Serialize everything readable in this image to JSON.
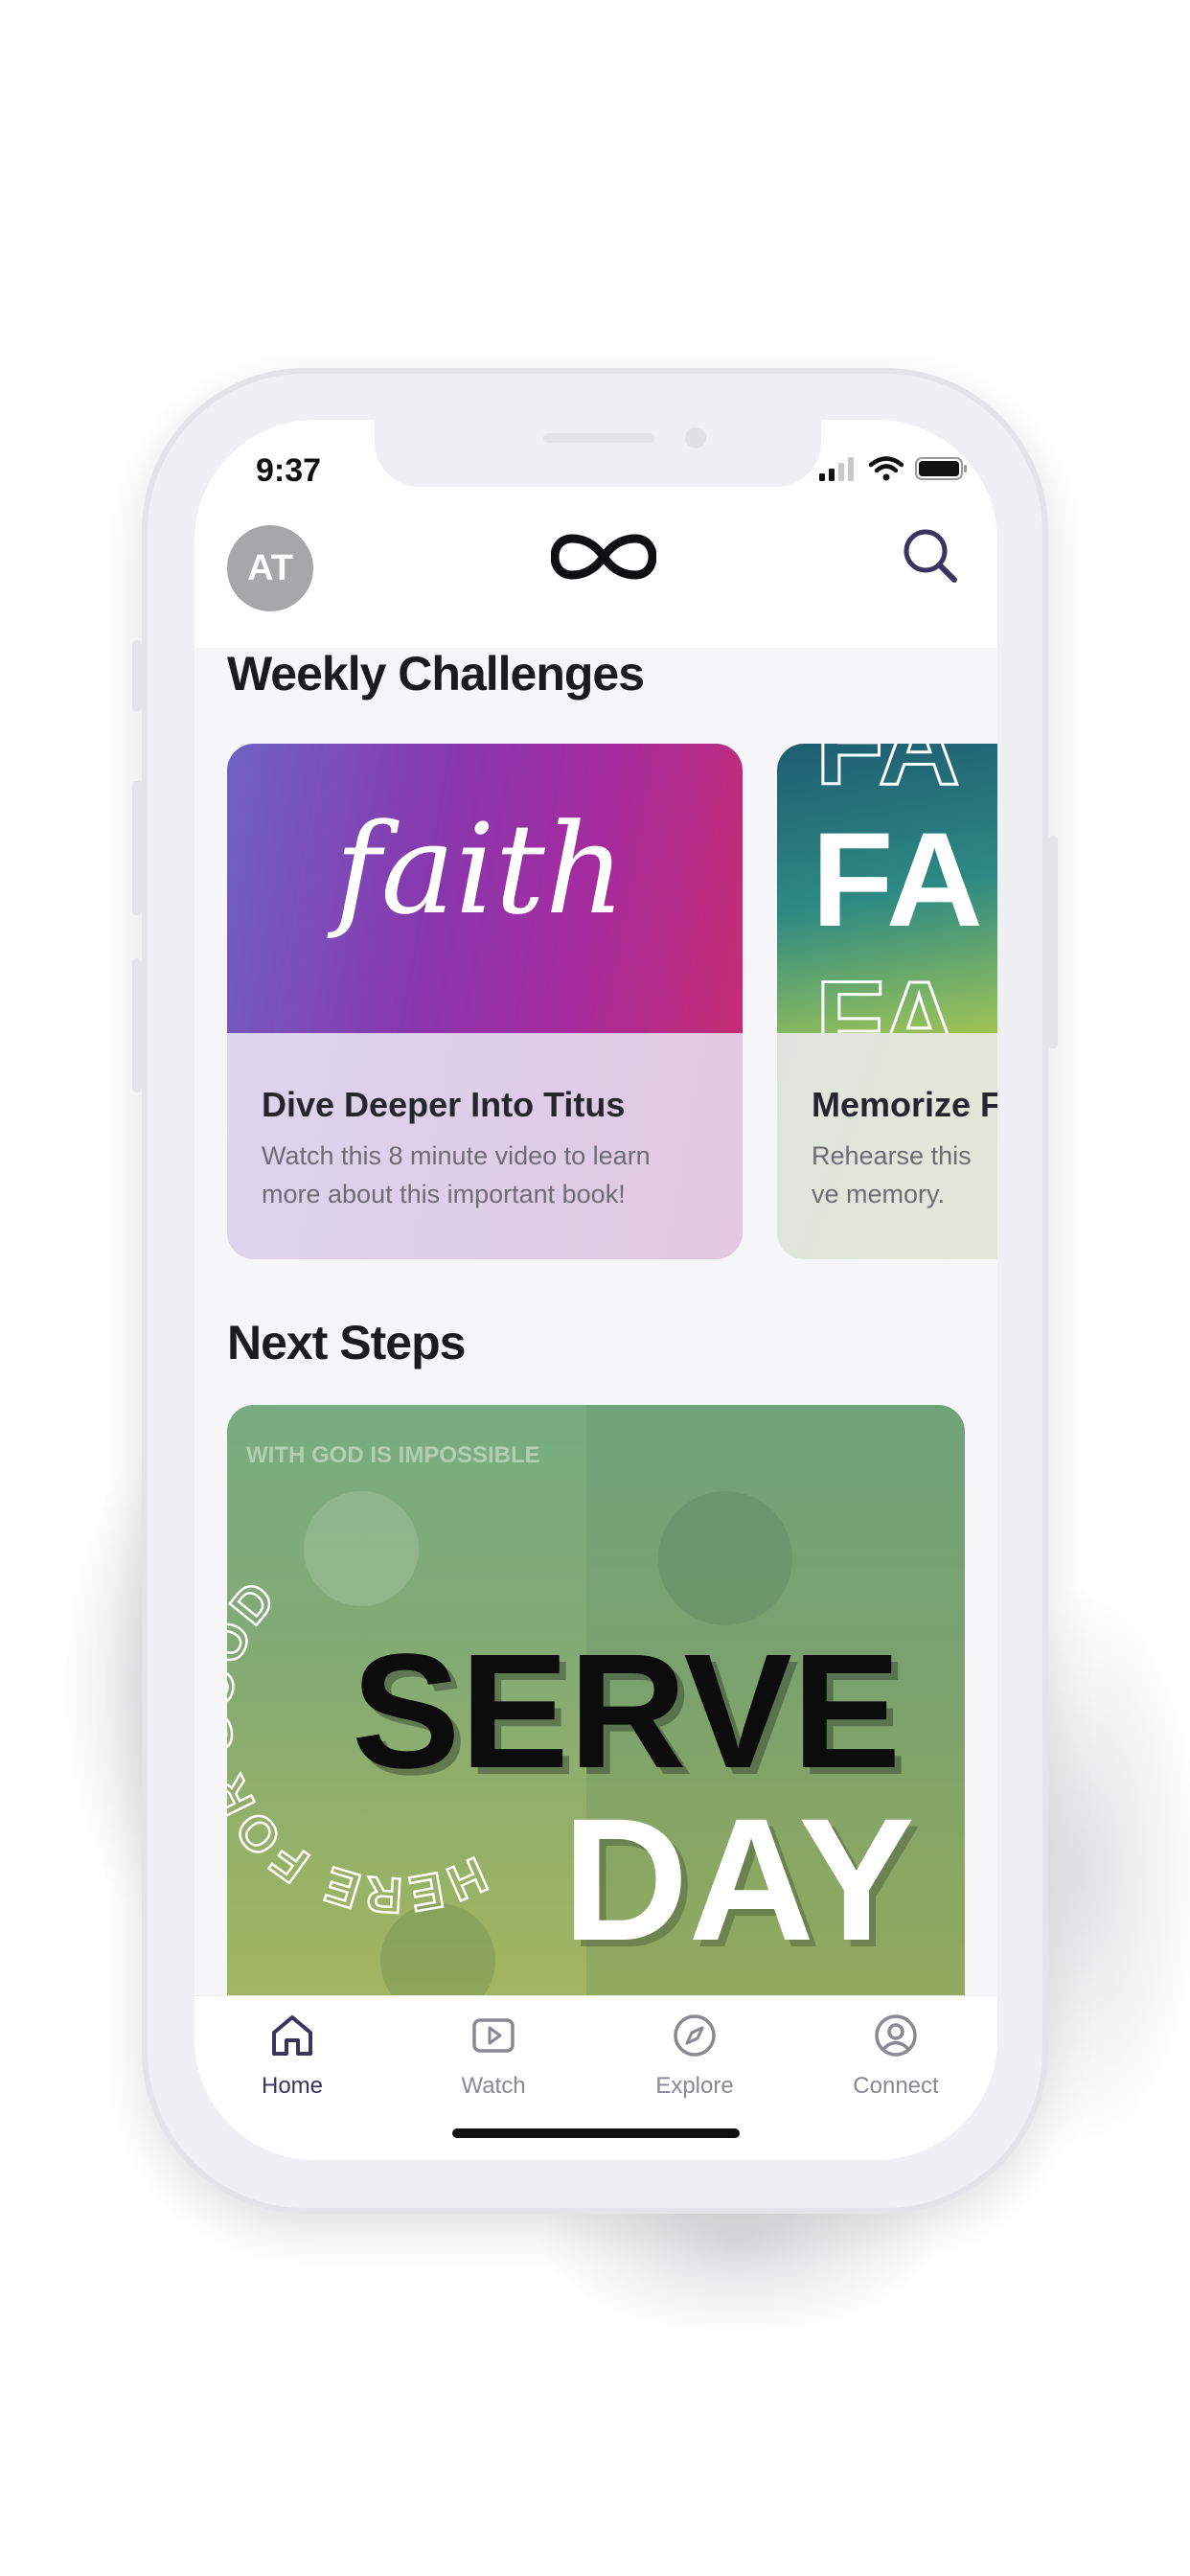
{
  "status_bar": {
    "time": "9:37"
  },
  "header": {
    "avatar_initials": "AT",
    "logo_icon": "infinity-logo-icon",
    "search_icon": "search-icon"
  },
  "sections": {
    "weekly_challenges": "Weekly Challenges",
    "next_steps": "Next Steps"
  },
  "challenges": [
    {
      "art_text": "faith",
      "title": "Dive Deeper Into Titus",
      "description": "Watch this 8 minute video to learn more about this important book!"
    },
    {
      "art_text": "FA",
      "title": "Memorize F",
      "description": "Rehearse this ve memory."
    }
  ],
  "next_step_banner": {
    "arc_text": "HERE FOR GOOD",
    "headline_1": "SERVE",
    "headline_2": "DAY",
    "background_text": "WITH GOD IS IMPOSSIBLE"
  },
  "tabs": [
    {
      "label": "Home",
      "icon": "home-icon",
      "active": true
    },
    {
      "label": "Watch",
      "icon": "play-icon",
      "active": false
    },
    {
      "label": "Explore",
      "icon": "compass-icon",
      "active": false
    },
    {
      "label": "Connect",
      "icon": "user-circle-icon",
      "active": false
    }
  ],
  "colors": {
    "accent": "#3a3560",
    "inactive": "#8a8890",
    "background": "#f6f6f9"
  }
}
